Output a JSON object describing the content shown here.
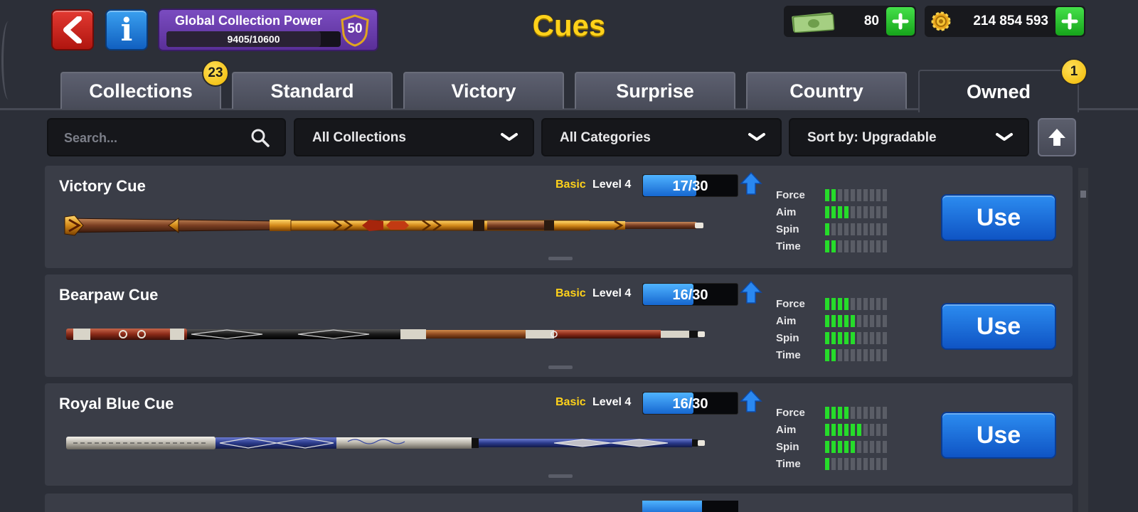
{
  "header": {
    "title": "Cues",
    "back_icon": "back-arrow-icon",
    "info_icon": "info-icon",
    "info_label": "i",
    "collection_power": {
      "label": "Global Collection Power",
      "value_text": "9405/10600",
      "current": 9405,
      "max": 10600,
      "level": "50"
    },
    "cash": {
      "icon": "cash-icon",
      "amount": "80"
    },
    "coins": {
      "icon": "coin-icon",
      "amount": "214 854 593"
    }
  },
  "tabs": [
    {
      "label": "Collections",
      "badge": "23",
      "active": false
    },
    {
      "label": "Standard",
      "active": false
    },
    {
      "label": "Victory",
      "active": false
    },
    {
      "label": "Surprise",
      "active": false
    },
    {
      "label": "Country",
      "active": false
    },
    {
      "label": "Owned",
      "badge": "1",
      "active": true
    }
  ],
  "filters": {
    "search_placeholder": "Search...",
    "collections": "All Collections",
    "categories": "All Categories",
    "sort": "Sort by: Upgradable"
  },
  "cues": [
    {
      "name": "Victory Cue",
      "tier": "Basic",
      "level": "Level 4",
      "progress_text": "17/30",
      "progress": 0.5667,
      "stats": [
        {
          "label": "Force",
          "value": 2
        },
        {
          "label": "Aim",
          "value": 4
        },
        {
          "label": "Spin",
          "value": 1
        },
        {
          "label": "Time",
          "value": 2
        }
      ],
      "use_label": "Use"
    },
    {
      "name": "Bearpaw Cue",
      "tier": "Basic",
      "level": "Level 4",
      "progress_text": "16/30",
      "progress": 0.5333,
      "stats": [
        {
          "label": "Force",
          "value": 4
        },
        {
          "label": "Aim",
          "value": 5
        },
        {
          "label": "Spin",
          "value": 5
        },
        {
          "label": "Time",
          "value": 2
        }
      ],
      "use_label": "Use"
    },
    {
      "name": "Royal Blue Cue",
      "tier": "Basic",
      "level": "Level 4",
      "progress_text": "16/30",
      "progress": 0.5333,
      "stats": [
        {
          "label": "Force",
          "value": 4
        },
        {
          "label": "Aim",
          "value": 6
        },
        {
          "label": "Spin",
          "value": 5
        },
        {
          "label": "Time",
          "value": 1
        }
      ],
      "use_label": "Use"
    }
  ],
  "stat_max": 10,
  "colors": {
    "accent_yellow": "#ffd21a",
    "stat_on": "#26dc2a",
    "use_blue": "#1667d0",
    "background": "#2c2f38"
  }
}
